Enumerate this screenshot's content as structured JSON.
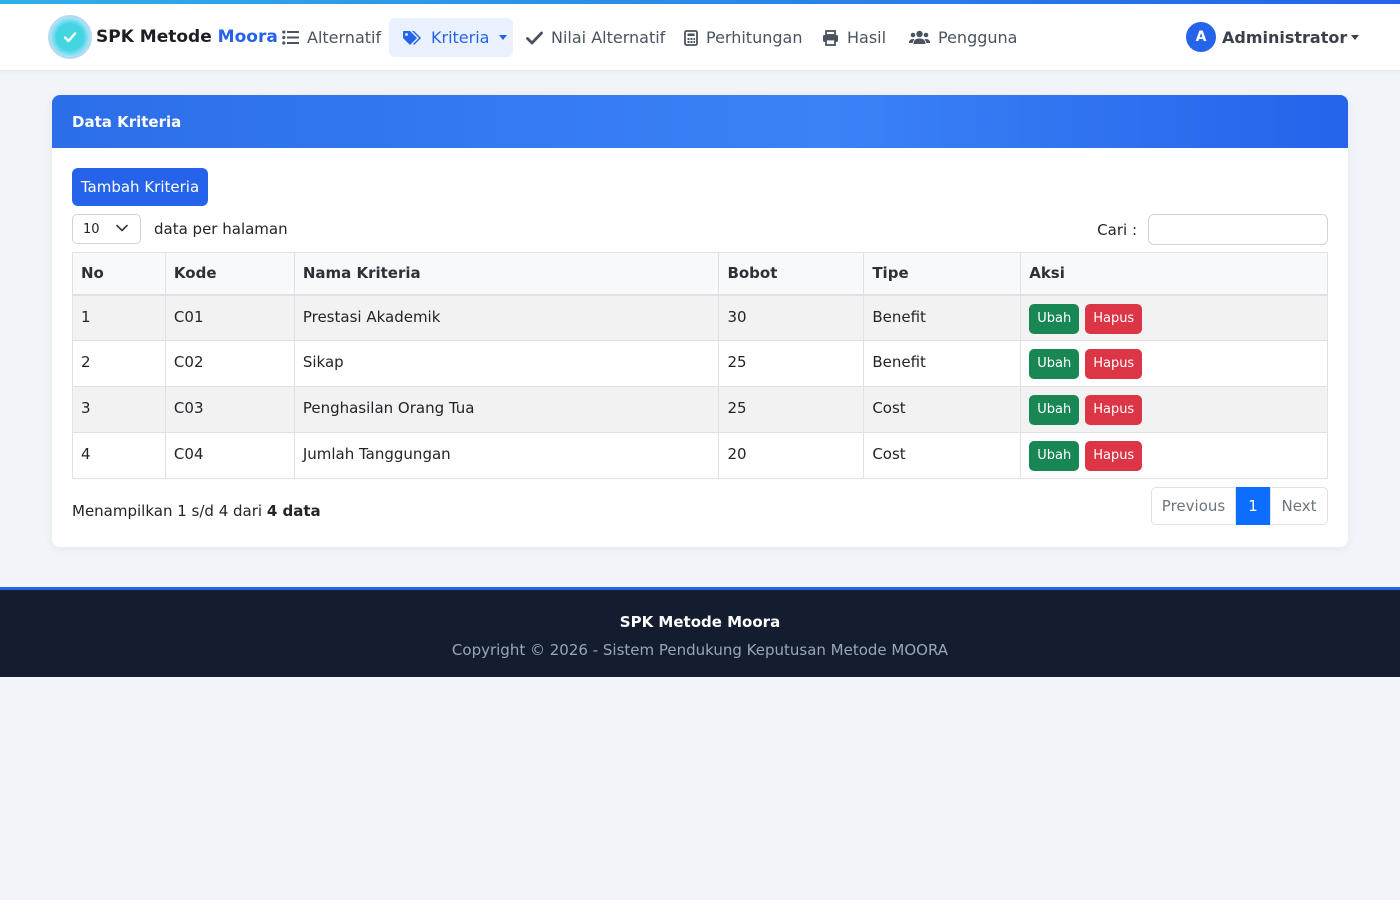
{
  "brand": {
    "name_prefix": "SPK Metode ",
    "name_accent": "Moora"
  },
  "nav": {
    "items": [
      {
        "label": "Alternatif",
        "icon": "list-icon"
      },
      {
        "label": "Kriteria",
        "icon": "tags-icon",
        "active": true
      },
      {
        "label": "Nilai Alternatif",
        "icon": "check-icon"
      },
      {
        "label": "Perhitungan",
        "icon": "calculator-icon"
      },
      {
        "label": "Hasil",
        "icon": "printer-icon"
      },
      {
        "label": "Pengguna",
        "icon": "users-icon"
      }
    ]
  },
  "user": {
    "initial": "A",
    "name": "Administrator"
  },
  "card": {
    "title": "Data Kriteria",
    "add_button": "Tambah Kriteria",
    "length_value": "10",
    "length_label": "data per halaman",
    "search_label": "Cari :",
    "search_value": ""
  },
  "table": {
    "headers": [
      "No",
      "Kode",
      "Nama Kriteria",
      "Bobot",
      "Tipe",
      "Aksi"
    ],
    "rows": [
      [
        "1",
        "C01",
        "Prestasi Akademik",
        "30",
        "Benefit"
      ],
      [
        "2",
        "C02",
        "Sikap",
        "25",
        "Benefit"
      ],
      [
        "3",
        "C03",
        "Penghasilan Orang Tua",
        "25",
        "Cost"
      ],
      [
        "4",
        "C04",
        "Jumlah Tanggungan",
        "20",
        "Cost"
      ]
    ],
    "edit_label": "Ubah",
    "delete_label": "Hapus"
  },
  "info": {
    "prefix": "Menampilkan 1 s/d 4 dari ",
    "total": "4 data"
  },
  "pagination": {
    "previous": "Previous",
    "current": "1",
    "next": "Next"
  },
  "footer": {
    "title": "SPK Metode Moora",
    "copyright": "Copyright © 2026 - Sistem Pendukung Keputusan Metode MOORA"
  },
  "colors": {
    "primary": "#2563eb",
    "success": "#198754",
    "danger": "#dc3545",
    "footer_bg": "#141c2f"
  }
}
